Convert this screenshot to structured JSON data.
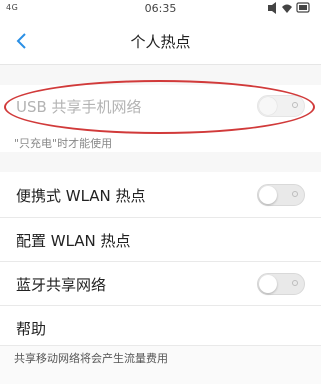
{
  "status_bar": {
    "signal": "4G",
    "time": "06:35",
    "icons": [
      "mute-icon",
      "wifi-icon",
      "battery-icon"
    ]
  },
  "header": {
    "title": "个人热点",
    "back_icon": "chevron-left-icon"
  },
  "usb_tethering": {
    "label": "USB 共享手机网络",
    "enabled": false,
    "note": "\"只充电\"时才能使用"
  },
  "items": [
    {
      "label": "便携式 WLAN 热点",
      "has_toggle": true,
      "on": false
    },
    {
      "label": "配置 WLAN 热点",
      "has_toggle": false
    },
    {
      "label": "蓝牙共享网络",
      "has_toggle": true,
      "on": false
    },
    {
      "label": "帮助",
      "has_toggle": false
    }
  ],
  "footer_note": "共享移动网络将会产生流量费用",
  "colors": {
    "annotation": "#d13a3a",
    "disabled_text": "#b3b3b3",
    "divider": "#e9e9e9"
  }
}
